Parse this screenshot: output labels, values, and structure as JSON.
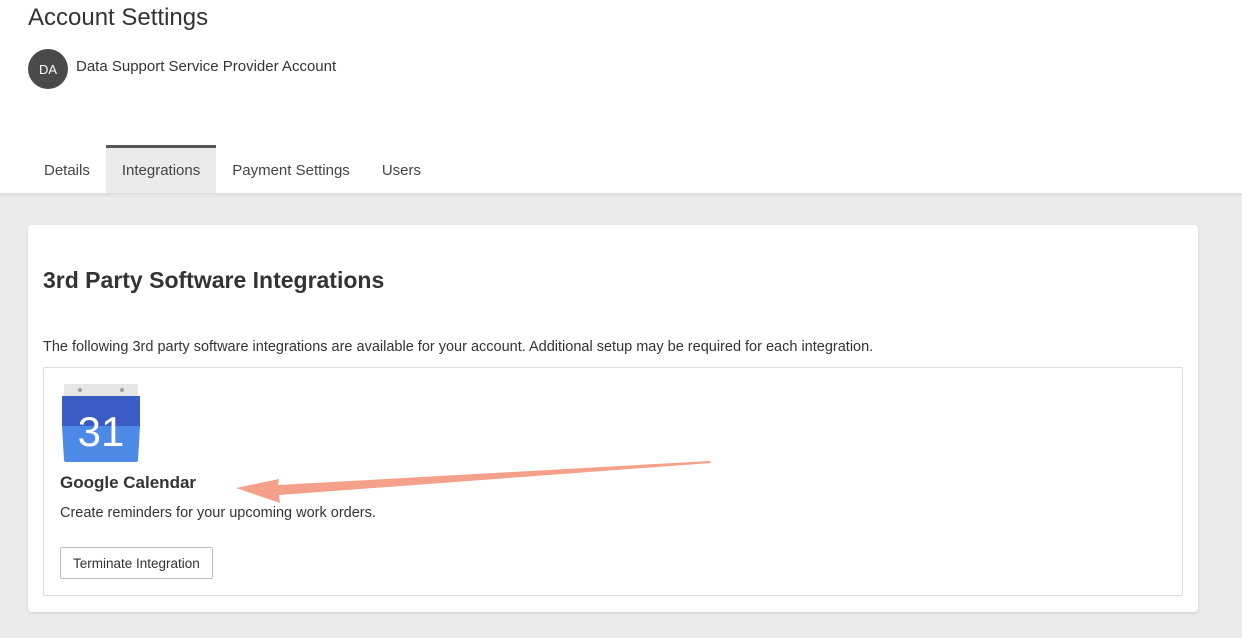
{
  "page": {
    "title": "Account Settings"
  },
  "account": {
    "initials": "DA",
    "name": "Data Support Service Provider Account"
  },
  "tabs": [
    {
      "label": "Details",
      "active": false
    },
    {
      "label": "Integrations",
      "active": true
    },
    {
      "label": "Payment Settings",
      "active": false
    },
    {
      "label": "Users",
      "active": false
    }
  ],
  "card": {
    "title": "3rd Party Software Integrations",
    "description": "The following 3rd party software integrations are available for your account. Additional setup may be required for each integration."
  },
  "integration": {
    "icon": "google-calendar-icon",
    "icon_number": "31",
    "name": "Google Calendar",
    "description": "Create reminders for your upcoming work orders.",
    "button_label": "Terminate Integration"
  },
  "colors": {
    "avatar_bg": "#4a4a4a",
    "page_bg": "#ebebeb",
    "annotation_arrow": "#f4a08a",
    "calendar_blue_dark": "#3b5cc4",
    "calendar_blue_light": "#4d8ae8"
  }
}
